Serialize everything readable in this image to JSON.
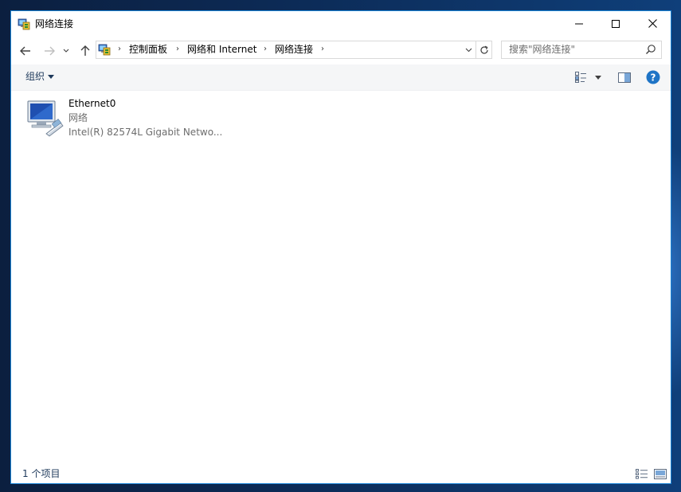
{
  "window": {
    "title": "网络连接"
  },
  "nav": {
    "breadcrumbs": [
      "控制面板",
      "网络和 Internet",
      "网络连接"
    ],
    "search_placeholder": "搜索\"网络连接\""
  },
  "commands": {
    "organize_label": "组织"
  },
  "items": [
    {
      "name": "Ethernet0",
      "type": "网络",
      "description": "Intel(R) 82574L Gigabit Netwo..."
    }
  ],
  "status": {
    "count_text": "1 个项目"
  },
  "colors": {
    "accent": "#1883d7",
    "command_bar": "#f5f6f7",
    "secondary_text": "#6d6d6d",
    "help_blue": "#1e74c6"
  },
  "icons": {
    "window": "network-connections-icon",
    "back": "back-arrow-icon",
    "forward": "forward-arrow-icon",
    "recent": "chevron-down-icon",
    "up": "up-arrow-icon",
    "refresh": "refresh-icon",
    "search": "search-icon",
    "change_view": "change-view-icon",
    "preview_pane": "preview-pane-icon",
    "help": "help-icon",
    "ethernet": "ethernet-adapter-icon"
  }
}
